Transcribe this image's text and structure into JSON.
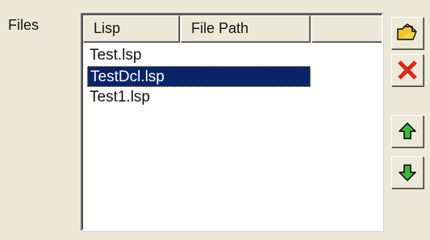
{
  "files_label": "Files",
  "columns": [
    "Lisp",
    "File Path",
    ""
  ],
  "rows": [
    "Test.lsp",
    "TestDcl.lsp",
    "Test1.lsp"
  ],
  "selected_row": 1,
  "buttons": {
    "open": {
      "icon": "open-folder-icon"
    },
    "delete": {
      "icon": "red-x-icon"
    },
    "move_up": {
      "icon": "green-up-arrow-icon"
    },
    "move_down": {
      "icon": "green-down-arrow-icon"
    }
  },
  "colors": {
    "selection": "#0a246a",
    "delete": "#e0241b",
    "arrow": "#3db83d",
    "folder": "#f5d742"
  }
}
